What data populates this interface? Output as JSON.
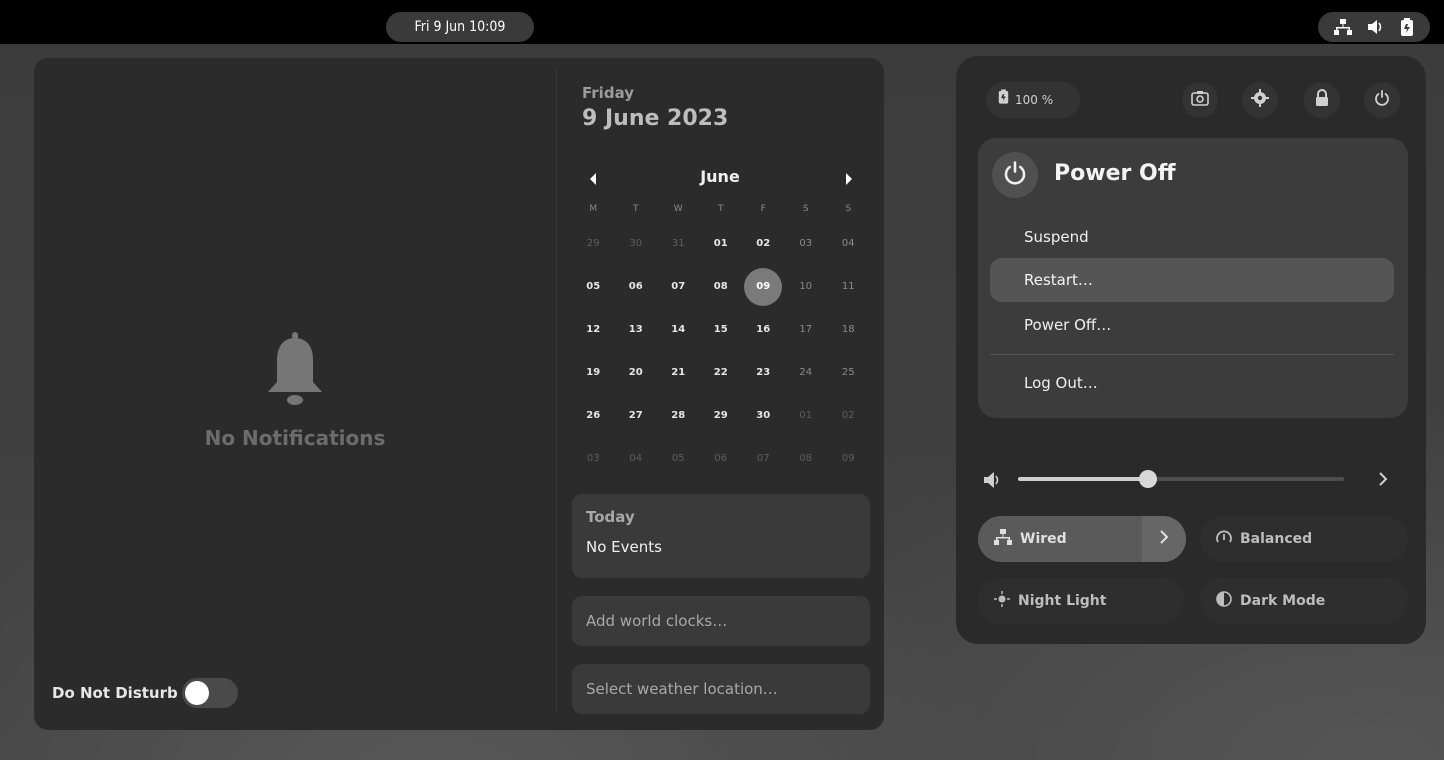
{
  "topbar": {
    "clock": "Fri 9 Jun  10:09",
    "status_icons": [
      "network-wired-icon",
      "volume-icon",
      "battery-icon"
    ]
  },
  "notifications": {
    "empty_text": "No Notifications",
    "dnd_label": "Do Not Disturb",
    "dnd_enabled": false
  },
  "calendar": {
    "day_name": "Friday",
    "full_date": "9 June 2023",
    "month": "June",
    "weekdays": [
      "M",
      "T",
      "W",
      "T",
      "F",
      "S",
      "S"
    ],
    "weeks": [
      [
        "29",
        "30",
        "31",
        "01",
        "02",
        "03",
        "04"
      ],
      [
        "05",
        "06",
        "07",
        "08",
        "09",
        "10",
        "11"
      ],
      [
        "12",
        "13",
        "14",
        "15",
        "16",
        "17",
        "18"
      ],
      [
        "19",
        "20",
        "21",
        "22",
        "23",
        "24",
        "25"
      ],
      [
        "26",
        "27",
        "28",
        "29",
        "30",
        "01",
        "02"
      ],
      [
        "03",
        "04",
        "05",
        "06",
        "07",
        "08",
        "09"
      ]
    ],
    "today": "09",
    "events_title": "Today",
    "events_text": "No Events",
    "world_clocks": "Add world clocks…",
    "weather": "Select weather location…"
  },
  "quick_settings": {
    "battery": "100 %",
    "power_menu": {
      "title": "Power Off",
      "items": [
        "Suspend",
        "Restart…",
        "Power Off…",
        "Log Out…"
      ]
    },
    "volume_level": 0.4,
    "tiles": {
      "wired": "Wired",
      "balanced": "Balanced",
      "night_light": "Night Light",
      "dark_mode": "Dark Mode"
    }
  }
}
